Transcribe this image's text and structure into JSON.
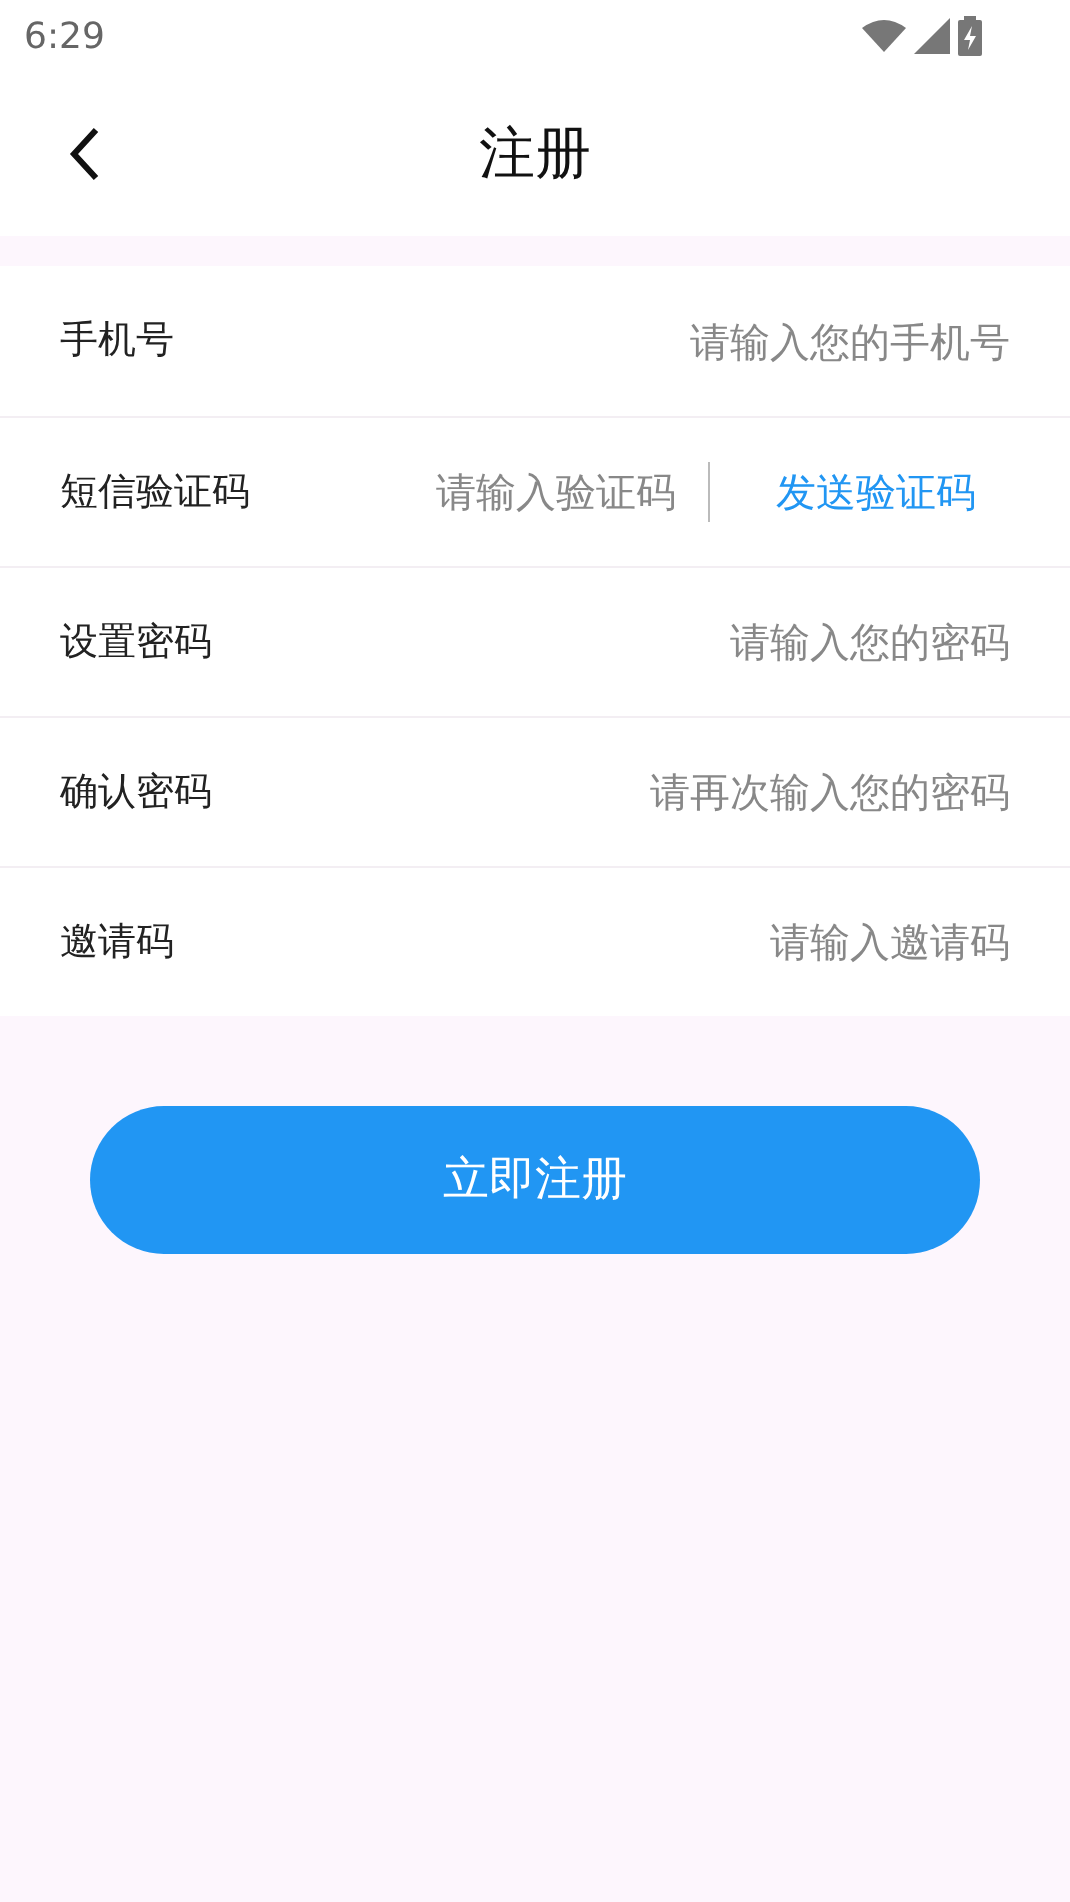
{
  "status_bar": {
    "time": "6:29"
  },
  "header": {
    "title": "注册"
  },
  "fields": [
    {
      "kind": "plain",
      "label": "手机号",
      "placeholder": "请输入您的手机号"
    },
    {
      "kind": "code",
      "label": "短信验证码",
      "placeholder": "请输入验证码",
      "action": "发送验证码"
    },
    {
      "kind": "plain",
      "label": "设置密码",
      "placeholder": "请输入您的密码"
    },
    {
      "kind": "plain",
      "label": "确认密码",
      "placeholder": "请再次输入您的密码"
    },
    {
      "kind": "plain",
      "label": "邀请码",
      "placeholder": "请输入邀请码"
    }
  ],
  "submit": {
    "label": "立即注册"
  }
}
